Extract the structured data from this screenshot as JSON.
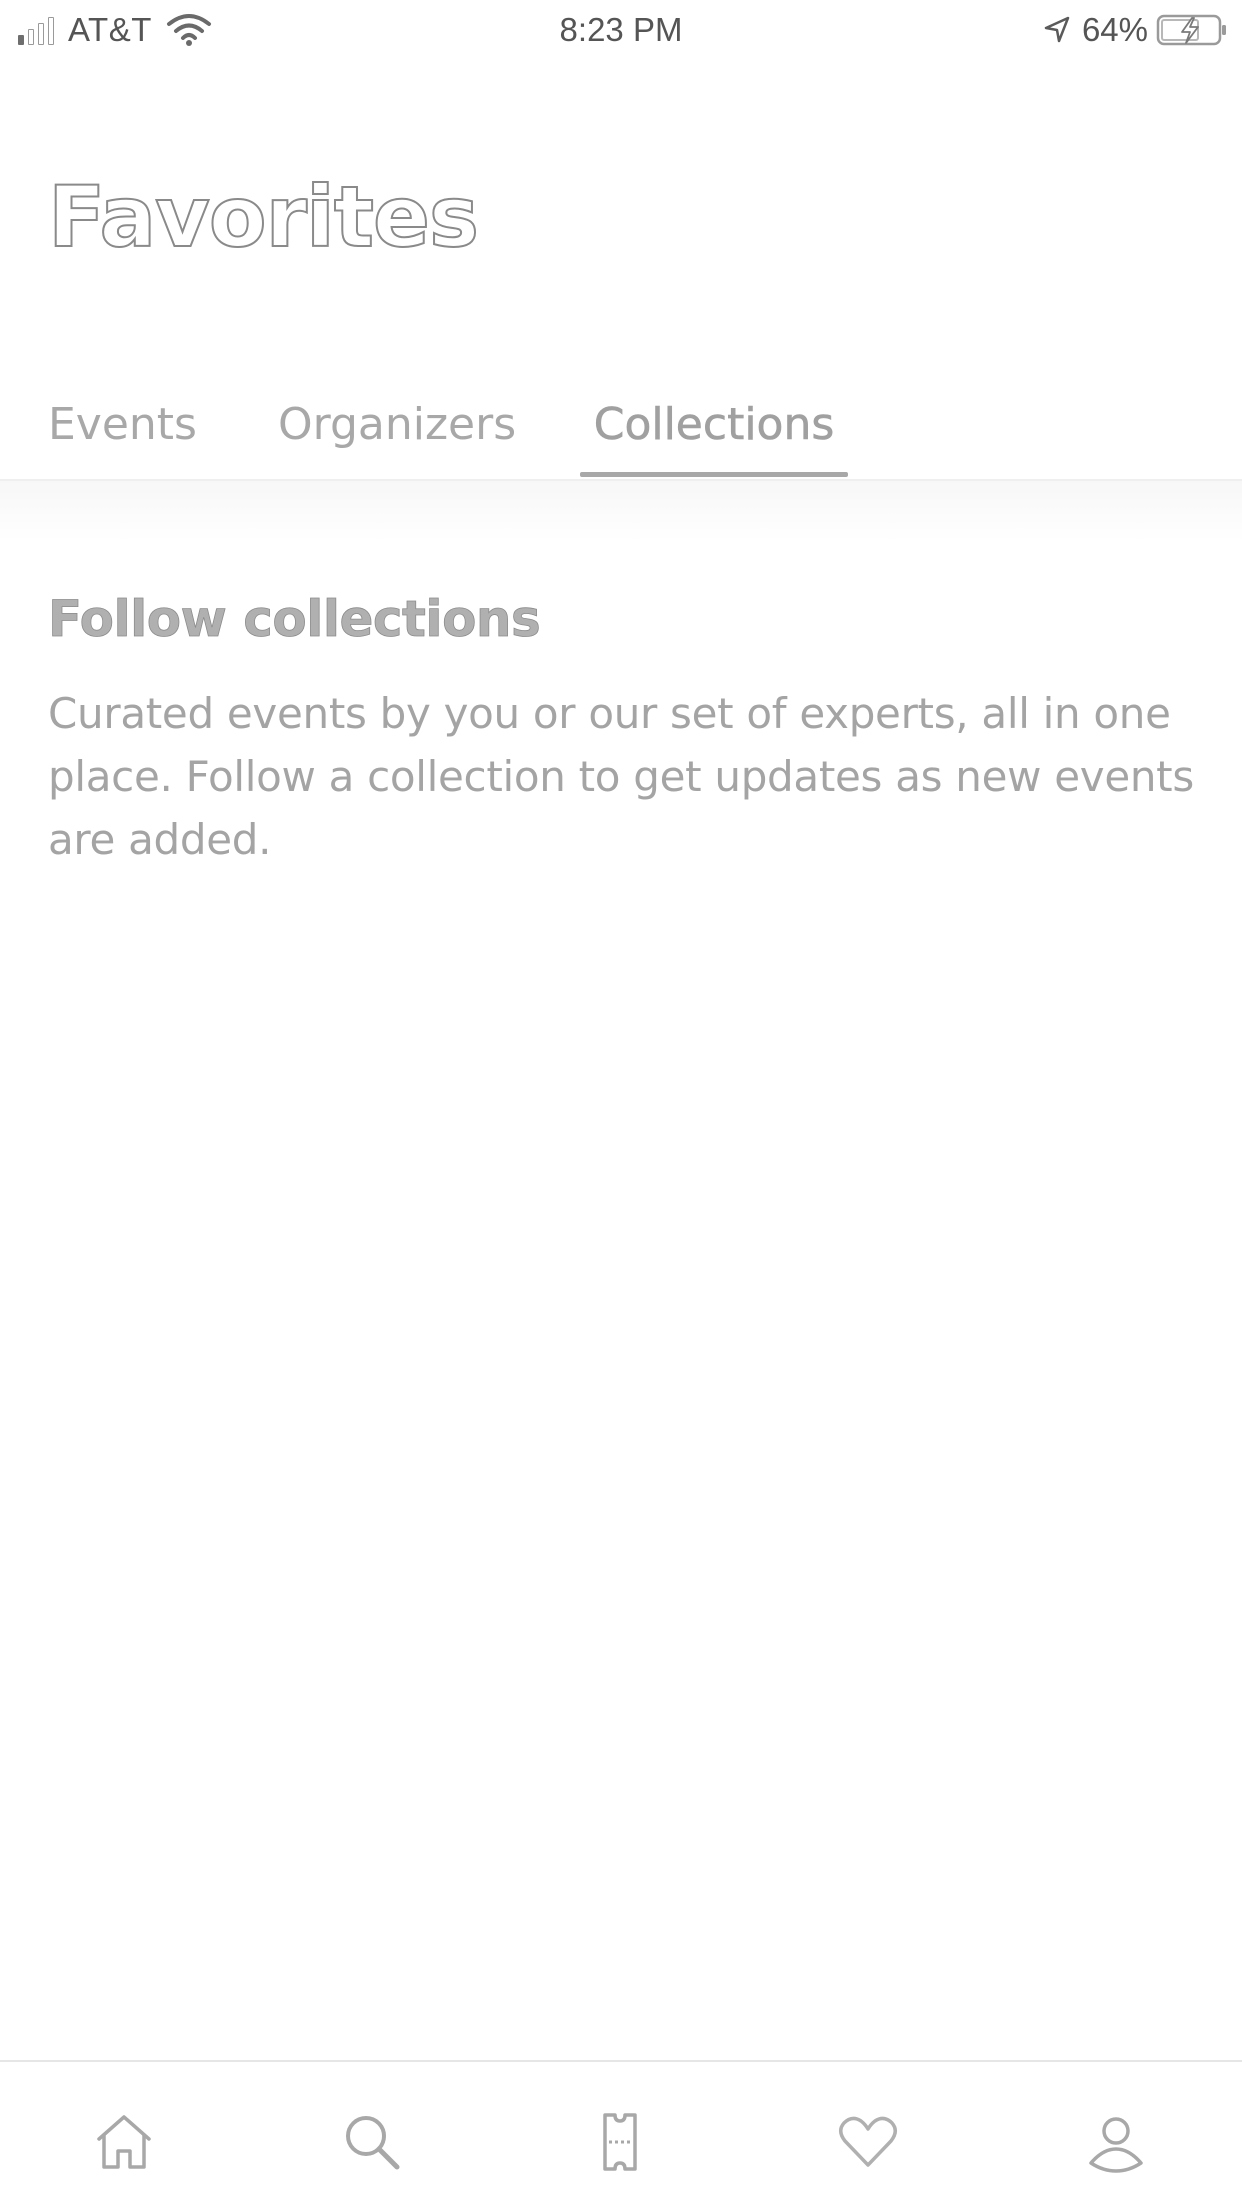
{
  "status_bar": {
    "carrier": "AT&T",
    "time": "8:23 PM",
    "battery_percent": "64%",
    "icons": [
      "signal-icon",
      "wifi-icon",
      "location-arrow-icon",
      "battery-charging-icon"
    ]
  },
  "header": {
    "title": "Favorites"
  },
  "tabs": [
    {
      "label": "Events",
      "active": false
    },
    {
      "label": "Organizers",
      "active": false
    },
    {
      "label": "Collections",
      "active": true
    }
  ],
  "empty_state": {
    "heading": "Follow collections",
    "body": "Curated events by you or our set of experts, all in one place. Follow a collection to get updates as new events are added."
  },
  "bottom_nav": {
    "items": [
      {
        "icon": "home-icon",
        "active": false
      },
      {
        "icon": "search-icon",
        "active": false
      },
      {
        "icon": "ticket-icon",
        "active": false
      },
      {
        "icon": "heart-icon",
        "active": true
      },
      {
        "icon": "profile-icon",
        "active": false
      }
    ]
  },
  "colors": {
    "text_primary": "#8a8a8a",
    "text_secondary": "#a4a4a4",
    "tab_indicator": "#a8a8a8",
    "background": "#ffffff",
    "status_text": "#555555"
  }
}
